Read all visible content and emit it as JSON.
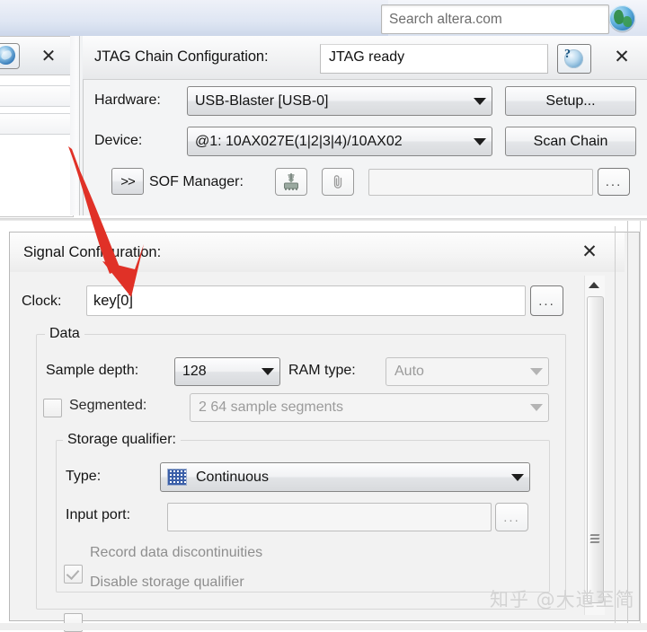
{
  "search": {
    "placeholder": "Search altera.com",
    "globe_icon": "globe-icon"
  },
  "left_panel": {
    "close_label": "✕",
    "icon": "quartus-swirl-icon"
  },
  "jtag_panel": {
    "title": "JTAG Chain Configuration:",
    "status": "JTAG ready",
    "help_label": "?",
    "close_label": "✕",
    "rows": {
      "hardware": {
        "label": "Hardware:",
        "value": "USB-Blaster [USB-0]",
        "button": "Setup..."
      },
      "device": {
        "label": "Device:",
        "value": "@1: 10AX027E(1|2|3|4)/10AX02",
        "button": "Scan Chain"
      },
      "sof": {
        "expand_label": ">>",
        "label": "SOF Manager:",
        "program_icon": "program-device-icon",
        "attach_icon": "paperclip-icon",
        "path_value": "",
        "browse_label": "..."
      }
    }
  },
  "signal_config": {
    "title": "Signal Configuration:",
    "close_label": "✕",
    "clock": {
      "label": "Clock:",
      "value": "key[0]",
      "browse_label": "..."
    },
    "data_group": {
      "legend": "Data",
      "sample_depth": {
        "label": "Sample depth:",
        "value": "128"
      },
      "ram_type": {
        "label": "RAM type:",
        "value": "Auto",
        "disabled": true
      },
      "segmented": {
        "label": "Segmented:",
        "checked": false,
        "value": "2  64 sample segments",
        "disabled": true
      },
      "storage_qualifier": {
        "legend": "Storage qualifier:",
        "type": {
          "label": "Type:",
          "value": "Continuous",
          "swatch_icon": "continuous-pattern-icon"
        },
        "input_port": {
          "label": "Input port:",
          "value": "",
          "browse_label": "..."
        },
        "record_discontinuities": {
          "label": "Record data discontinuities",
          "checked": true,
          "disabled": true
        },
        "disable_storage_qualifier": {
          "label": "Disable storage qualifier",
          "checked": false,
          "disabled": true
        }
      }
    }
  },
  "scrollbar": {
    "up_arrow": "scroll-up-arrow-icon",
    "grip": "scrollbar-grip-icon"
  },
  "annotation": {
    "arrow_color": "#e03127",
    "arrow_name": "red-pointer-arrow"
  },
  "watermark": {
    "text": "知乎 @大道至简"
  },
  "colors": {
    "accent_blue": "#3b5fa8",
    "panel_bg": "#f2f2f2",
    "annotation_red": "#e03127"
  }
}
